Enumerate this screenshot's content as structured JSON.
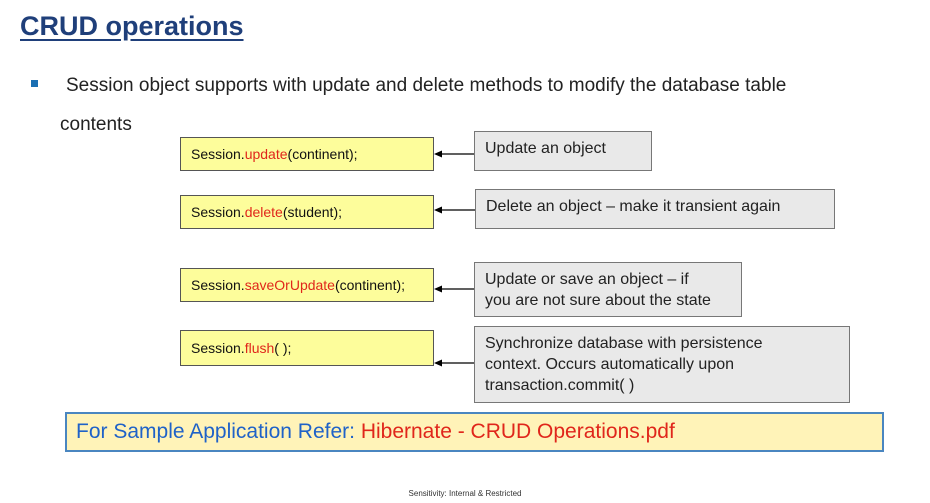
{
  "title": "CRUD operations",
  "bullet": {
    "line1": "Session object supports with update and delete methods to modify the database table",
    "line2": "contents"
  },
  "rows": [
    {
      "prefix": "Session.",
      "method": "update",
      "suffix": "(continent);",
      "description": [
        "Update an object"
      ]
    },
    {
      "prefix": "Session.",
      "method": "delete",
      "suffix": "(student);",
      "description": [
        "Delete an object – make it transient again"
      ]
    },
    {
      "prefix": "Session.",
      "method": "saveOrUpdate",
      "suffix": "(continent);",
      "description": [
        "Update or save an object – if",
        "you are not sure about the state"
      ]
    },
    {
      "prefix": "Session.",
      "method": "flush",
      "suffix": "( );",
      "description": [
        "Synchronize database with persistence",
        "context. Occurs automatically upon",
        "transaction.commit( )"
      ]
    }
  ],
  "reference": {
    "label": "For Sample Application Refer: ",
    "file": "Hibernate - CRUD Operations.pdf"
  },
  "footer": "Sensitivity: Internal & Restricted",
  "colors": {
    "title": "#1f3f7a",
    "method": "#e0261b",
    "code_bg": "#fdfd9b",
    "desc_bg": "#e9e9e9",
    "ref_bg": "#fff3b8",
    "ref_border": "#4a86c0",
    "ref_label": "#1f62c8"
  }
}
